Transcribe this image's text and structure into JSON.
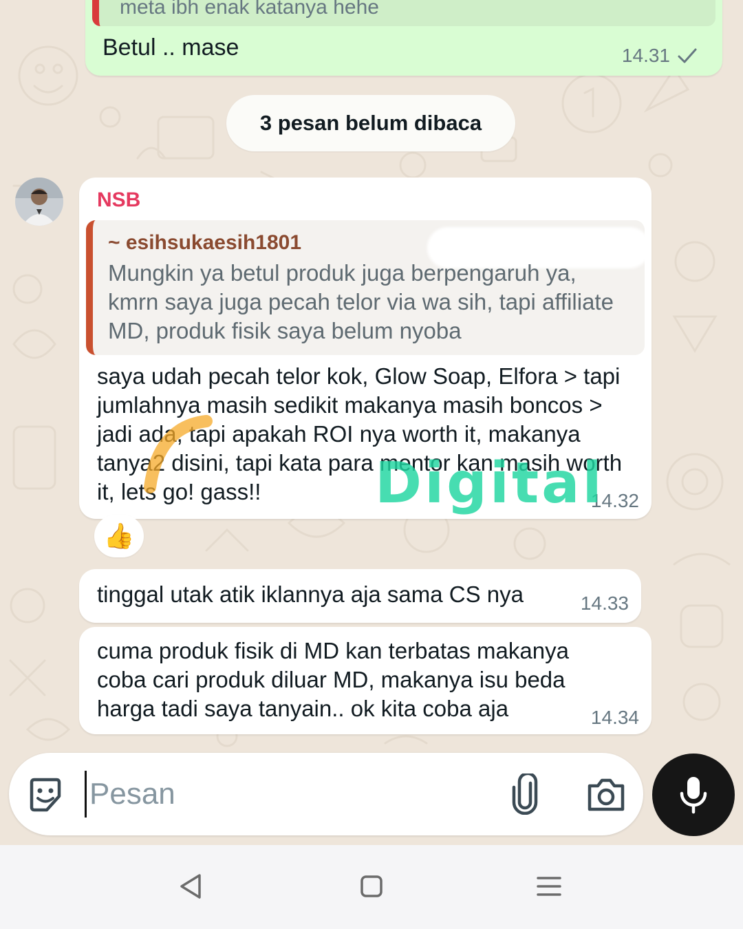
{
  "outgoing": {
    "quote_text": "meta ibh enak katanya hehe",
    "text": "Betul .. mase",
    "time": "14.31",
    "status_icon": "single-check-icon"
  },
  "unread_banner": "3 pesan belum dibaca",
  "messages": [
    {
      "sender": "NSB",
      "quote": {
        "author": "~ esihsukaesih1801",
        "text": "Mungkin ya betul produk juga berpengaruh ya, kmrn saya juga pecah telor via wa sih, tapi affiliate MD, produk fisik saya belum nyoba"
      },
      "text": "saya udah pecah telor kok, Glow Soap, Elfora > tapi jumlahnya masih sedikit makanya masih boncos > jadi ada, tapi apakah ROI nya worth it, makanya tanya2 disini, tapi kata para mentor kan masih worth it, lets go! gass!!",
      "time": "14.32",
      "reaction": "👍"
    },
    {
      "text": "tinggal utak atik iklannya aja sama CS nya",
      "time": "14.33"
    },
    {
      "text": "cuma produk fisik di MD kan terbatas makanya coba cari produk diluar MD, makanya isu beda harga tadi saya tanyain..  ok kita coba aja",
      "time": "14.34"
    }
  ],
  "watermark": "Digital",
  "composer": {
    "placeholder": "Pesan",
    "value": "",
    "icons": [
      "sticker-icon",
      "attach-icon",
      "camera-icon",
      "mic-icon"
    ]
  },
  "colors": {
    "outgoing_bubble": "#d9fdd3",
    "incoming_bubble": "#ffffff",
    "sender_name": "#e5395f",
    "quote_bar": "#c9502f",
    "chat_background": "#eee5da",
    "mic_button": "#161616"
  },
  "nav": [
    "back-icon",
    "home-icon",
    "recents-icon"
  ]
}
